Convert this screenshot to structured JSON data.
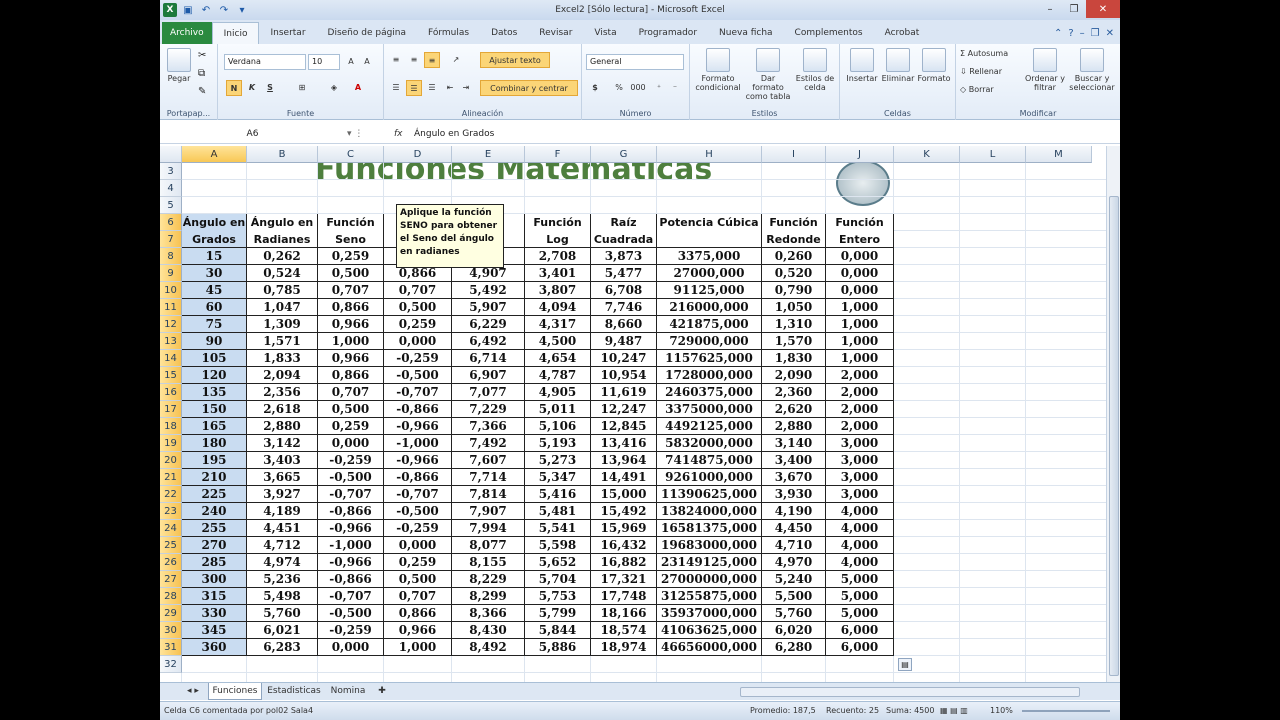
{
  "window": {
    "title": "Excel2  [Sólo lectura]  -  Microsoft Excel"
  },
  "tabs": [
    "Archivo",
    "Inicio",
    "Insertar",
    "Diseño de página",
    "Fórmulas",
    "Datos",
    "Revisar",
    "Vista",
    "Programador",
    "Nueva ficha",
    "Complementos",
    "Acrobat"
  ],
  "ribbon": {
    "paste": "Pegar",
    "font_name": "Verdana",
    "font_size": "10",
    "bold": "N",
    "italic": "K",
    "underline": "S",
    "wrap_text": "Ajustar texto",
    "merge_center": "Combinar y centrar",
    "number_format": "General",
    "currency": "$",
    "percent": "%",
    "thousands": "000",
    "cond_format": "Formato condicional",
    "format_table": "Dar formato como tabla",
    "cell_styles": "Estilos de celda",
    "insert": "Insertar",
    "delete": "Eliminar",
    "format": "Formato",
    "autosum": "Autosuma",
    "fill": "Rellenar",
    "clear": "Borrar",
    "sort_filter": "Ordenar y filtrar",
    "find_select": "Buscar y seleccionar",
    "groups": {
      "portapapeles": "Portapap...",
      "fuente": "Fuente",
      "alineacion": "Alineación",
      "numero": "Número",
      "estilos": "Estilos",
      "celdas": "Celdas",
      "modificar": "Modificar"
    }
  },
  "formula": {
    "name_box": "A6",
    "fx": "fx",
    "content": "Ángulo en Grados"
  },
  "columns": [
    "A",
    "B",
    "C",
    "D",
    "E",
    "F",
    "G",
    "H",
    "I",
    "J",
    "K",
    "L",
    "M"
  ],
  "rows_header": [
    "3",
    "4",
    "5",
    "6",
    "7",
    "8",
    "9",
    "10",
    "11",
    "12",
    "13",
    "14",
    "15",
    "16",
    "17",
    "18",
    "19",
    "20",
    "21",
    "22",
    "23",
    "24",
    "25",
    "26",
    "27",
    "28",
    "29",
    "30",
    "31",
    "32"
  ],
  "sheet_title": "Funciones Matemáticas",
  "table_headers": [
    [
      "Ángulo en",
      "Grados"
    ],
    [
      "Ángulo en",
      "Radianes"
    ],
    [
      "Función",
      "Seno"
    ],
    [
      "",
      ""
    ],
    [
      "",
      "n"
    ],
    [
      "Función",
      "Log"
    ],
    [
      "Raíz",
      "Cuadrada"
    ],
    [
      "",
      "Potencia Cúbica"
    ],
    [
      "Función",
      "Redonde"
    ],
    [
      "Función",
      "Entero"
    ]
  ],
  "tooltip": "Aplique la función SENO para obtener el Seno del ángulo en radianes",
  "table_rows": [
    [
      "15",
      "0,262",
      "0,259",
      "",
      "",
      "2,708",
      "3,873",
      "3375,000",
      "0,260",
      "0,000"
    ],
    [
      "30",
      "0,524",
      "0,500",
      "0,866",
      "4,907",
      "3,401",
      "5,477",
      "27000,000",
      "0,520",
      "0,000"
    ],
    [
      "45",
      "0,785",
      "0,707",
      "0,707",
      "5,492",
      "3,807",
      "6,708",
      "91125,000",
      "0,790",
      "0,000"
    ],
    [
      "60",
      "1,047",
      "0,866",
      "0,500",
      "5,907",
      "4,094",
      "7,746",
      "216000,000",
      "1,050",
      "1,000"
    ],
    [
      "75",
      "1,309",
      "0,966",
      "0,259",
      "6,229",
      "4,317",
      "8,660",
      "421875,000",
      "1,310",
      "1,000"
    ],
    [
      "90",
      "1,571",
      "1,000",
      "0,000",
      "6,492",
      "4,500",
      "9,487",
      "729000,000",
      "1,570",
      "1,000"
    ],
    [
      "105",
      "1,833",
      "0,966",
      "-0,259",
      "6,714",
      "4,654",
      "10,247",
      "1157625,000",
      "1,830",
      "1,000"
    ],
    [
      "120",
      "2,094",
      "0,866",
      "-0,500",
      "6,907",
      "4,787",
      "10,954",
      "1728000,000",
      "2,090",
      "2,000"
    ],
    [
      "135",
      "2,356",
      "0,707",
      "-0,707",
      "7,077",
      "4,905",
      "11,619",
      "2460375,000",
      "2,360",
      "2,000"
    ],
    [
      "150",
      "2,618",
      "0,500",
      "-0,866",
      "7,229",
      "5,011",
      "12,247",
      "3375000,000",
      "2,620",
      "2,000"
    ],
    [
      "165",
      "2,880",
      "0,259",
      "-0,966",
      "7,366",
      "5,106",
      "12,845",
      "4492125,000",
      "2,880",
      "2,000"
    ],
    [
      "180",
      "3,142",
      "0,000",
      "-1,000",
      "7,492",
      "5,193",
      "13,416",
      "5832000,000",
      "3,140",
      "3,000"
    ],
    [
      "195",
      "3,403",
      "-0,259",
      "-0,966",
      "7,607",
      "5,273",
      "13,964",
      "7414875,000",
      "3,400",
      "3,000"
    ],
    [
      "210",
      "3,665",
      "-0,500",
      "-0,866",
      "7,714",
      "5,347",
      "14,491",
      "9261000,000",
      "3,670",
      "3,000"
    ],
    [
      "225",
      "3,927",
      "-0,707",
      "-0,707",
      "7,814",
      "5,416",
      "15,000",
      "11390625,000",
      "3,930",
      "3,000"
    ],
    [
      "240",
      "4,189",
      "-0,866",
      "-0,500",
      "7,907",
      "5,481",
      "15,492",
      "13824000,000",
      "4,190",
      "4,000"
    ],
    [
      "255",
      "4,451",
      "-0,966",
      "-0,259",
      "7,994",
      "5,541",
      "15,969",
      "16581375,000",
      "4,450",
      "4,000"
    ],
    [
      "270",
      "4,712",
      "-1,000",
      "0,000",
      "8,077",
      "5,598",
      "16,432",
      "19683000,000",
      "4,710",
      "4,000"
    ],
    [
      "285",
      "4,974",
      "-0,966",
      "0,259",
      "8,155",
      "5,652",
      "16,882",
      "23149125,000",
      "4,970",
      "4,000"
    ],
    [
      "300",
      "5,236",
      "-0,866",
      "0,500",
      "8,229",
      "5,704",
      "17,321",
      "27000000,000",
      "5,240",
      "5,000"
    ],
    [
      "315",
      "5,498",
      "-0,707",
      "0,707",
      "8,299",
      "5,753",
      "17,748",
      "31255875,000",
      "5,500",
      "5,000"
    ],
    [
      "330",
      "5,760",
      "-0,500",
      "0,866",
      "8,366",
      "5,799",
      "18,166",
      "35937000,000",
      "5,760",
      "5,000"
    ],
    [
      "345",
      "6,021",
      "-0,259",
      "0,966",
      "8,430",
      "5,844",
      "18,574",
      "41063625,000",
      "6,020",
      "6,000"
    ],
    [
      "360",
      "6,283",
      "0,000",
      "1,000",
      "8,492",
      "5,886",
      "18,974",
      "46656000,000",
      "6,280",
      "6,000"
    ]
  ],
  "sheets": [
    "Funciones",
    "Estadisticas",
    "Nomina"
  ],
  "status": {
    "left": "Celda C6 comentada por pol02 Sala4",
    "average": "Promedio: 187,5",
    "count": "Recuento: 25",
    "sum": "Suma: 4500",
    "zoom": "110%"
  }
}
